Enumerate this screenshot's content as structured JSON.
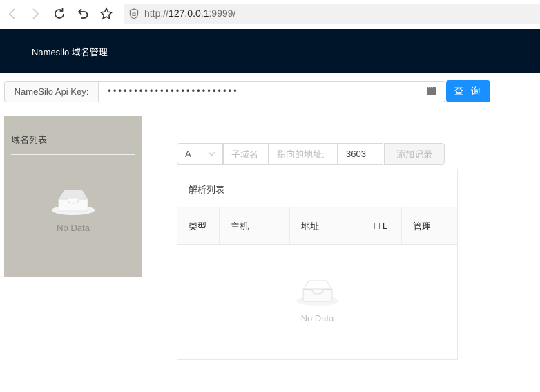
{
  "browser": {
    "url_prefix": "http://",
    "url_host": "127.0.0.1",
    "url_suffix": ":9999/",
    "icons": [
      "back-icon",
      "forward-icon",
      "reload-icon",
      "undo-icon",
      "star-icon",
      "shield-icon"
    ]
  },
  "header": {
    "title": "Namesilo 域名管理"
  },
  "api_key": {
    "label": "NameSilo Api Key:",
    "masked_value": "•••••••••••••••••••••••••",
    "query_button": "查 询"
  },
  "domain_list": {
    "title": "域名列表",
    "empty_text": "No Data"
  },
  "record_form": {
    "type_value": "A",
    "subdomain_placeholder": "子域名",
    "address_placeholder": "指向的地址:",
    "ttl_value": "3603",
    "add_button": "添加记录"
  },
  "records": {
    "title": "解析列表",
    "columns": [
      "类型",
      "主机",
      "地址",
      "TTL",
      "管理"
    ],
    "empty_text": "No Data"
  },
  "colors": {
    "header_bg": "#001529",
    "primary": "#1890ff",
    "domain_card_bg": "#c3c1b8"
  }
}
